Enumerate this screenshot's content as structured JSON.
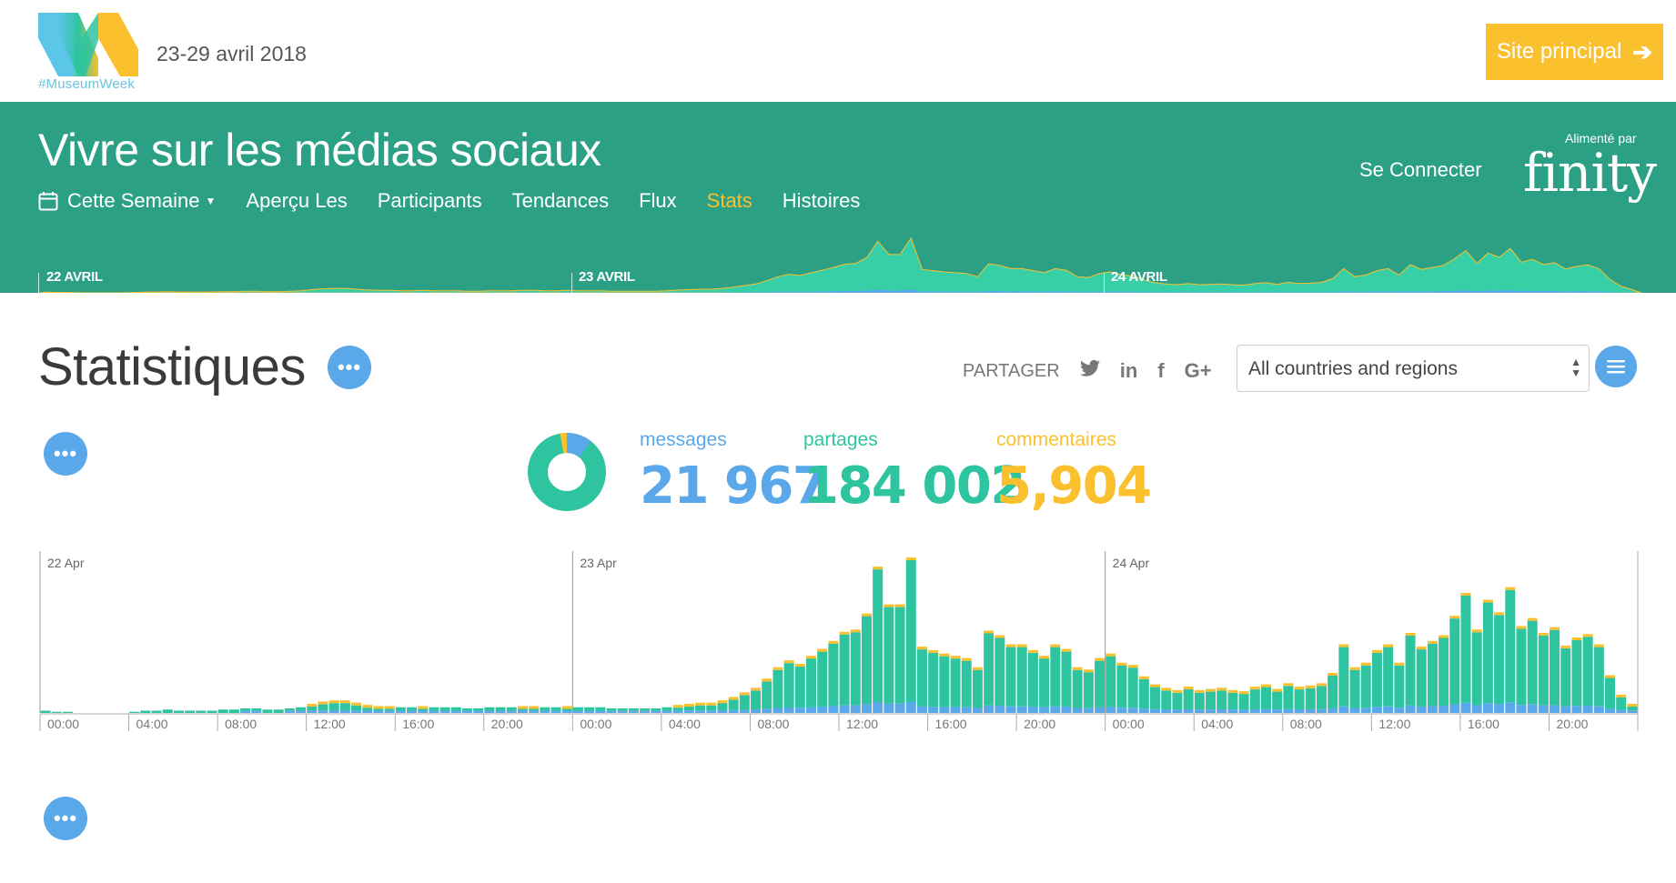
{
  "header": {
    "logo_tag": "#MuseumWeek",
    "date_range": "23-29 avril 2018",
    "site_button": "Site principal",
    "site_button_icon": "arrow-right-icon"
  },
  "hero": {
    "title": "Vivre sur les médias sociaux",
    "nav": [
      {
        "label": "Cette Semaine",
        "active": false
      },
      {
        "label": "Aperçu Les",
        "active": false
      },
      {
        "label": "Participants",
        "active": false
      },
      {
        "label": "Tendances",
        "active": false
      },
      {
        "label": "Flux",
        "active": false
      },
      {
        "label": "Stats",
        "active": true
      },
      {
        "label": "Histoires",
        "active": false
      }
    ],
    "login": "Se Connecter",
    "powered_by": "Alimenté par",
    "brand": "finity",
    "timeline_labels": [
      "22 AVRIL",
      "23 AVRIL",
      "24 AVRIL"
    ]
  },
  "stats": {
    "title": "Statistiques",
    "share_label": "PARTAGER",
    "share_icons": [
      "twitter-icon",
      "linkedin-icon",
      "facebook-icon",
      "google-plus-icon"
    ],
    "region_select": "All countries and regions",
    "kpis": [
      {
        "label": "messages",
        "value": "21 967",
        "color": "#5aa8ea"
      },
      {
        "label": "partages",
        "value": "184 002",
        "color": "#2ec4a0"
      },
      {
        "label": "commentaires",
        "value": "5,904",
        "color": "#fbc02d"
      }
    ]
  },
  "colors": {
    "green": "#2ca085",
    "teal": "#2ec4a0",
    "blue": "#5aa8ea",
    "yellow": "#fbc02d"
  },
  "chart_data": {
    "type": "bar",
    "stacked": true,
    "day_labels": [
      "22 Apr",
      "23 Apr",
      "24 Apr"
    ],
    "x_tick_labels": [
      "00:00",
      "04:00",
      "08:00",
      "12:00",
      "16:00",
      "20:00",
      "00:00",
      "04:00",
      "08:00",
      "12:00",
      "16:00",
      "20:00",
      "00:00",
      "04:00",
      "08:00",
      "12:00",
      "16:00",
      "20:00"
    ],
    "bin_minutes": 30,
    "series": [
      {
        "name": "partages",
        "color": "#2ec4a0"
      },
      {
        "name": "messages",
        "color": "#5aa8ea"
      },
      {
        "name": "commentaires",
        "color": "#fbc02d"
      }
    ],
    "totals": [
      2,
      1,
      1,
      0,
      0,
      0,
      0,
      0,
      1,
      2,
      2,
      3,
      2,
      2,
      2,
      2,
      3,
      3,
      4,
      4,
      3,
      3,
      4,
      5,
      8,
      10,
      11,
      11,
      9,
      7,
      6,
      6,
      5,
      5,
      6,
      5,
      5,
      5,
      4,
      4,
      5,
      5,
      5,
      6,
      6,
      5,
      5,
      6,
      5,
      5,
      5,
      4,
      4,
      4,
      4,
      4,
      5,
      7,
      8,
      9,
      9,
      11,
      14,
      18,
      22,
      30,
      40,
      46,
      43,
      50,
      56,
      63,
      71,
      73,
      87,
      128,
      95,
      95,
      136,
      58,
      55,
      52,
      50,
      48,
      40,
      72,
      68,
      60,
      60,
      55,
      50,
      60,
      56,
      40,
      38,
      48,
      52,
      44,
      42,
      32,
      25,
      22,
      20,
      23,
      20,
      21,
      22,
      20,
      19,
      23,
      25,
      21,
      26,
      23,
      24,
      26,
      35,
      60,
      40,
      44,
      55,
      60,
      44,
      70,
      58,
      63,
      68,
      85,
      105,
      73,
      99,
      88,
      110,
      76,
      83,
      70,
      75,
      59,
      66,
      69,
      60,
      33,
      16,
      8
    ],
    "blue_share": 0.07,
    "yellow_share": 0.02,
    "y_max": 140
  }
}
